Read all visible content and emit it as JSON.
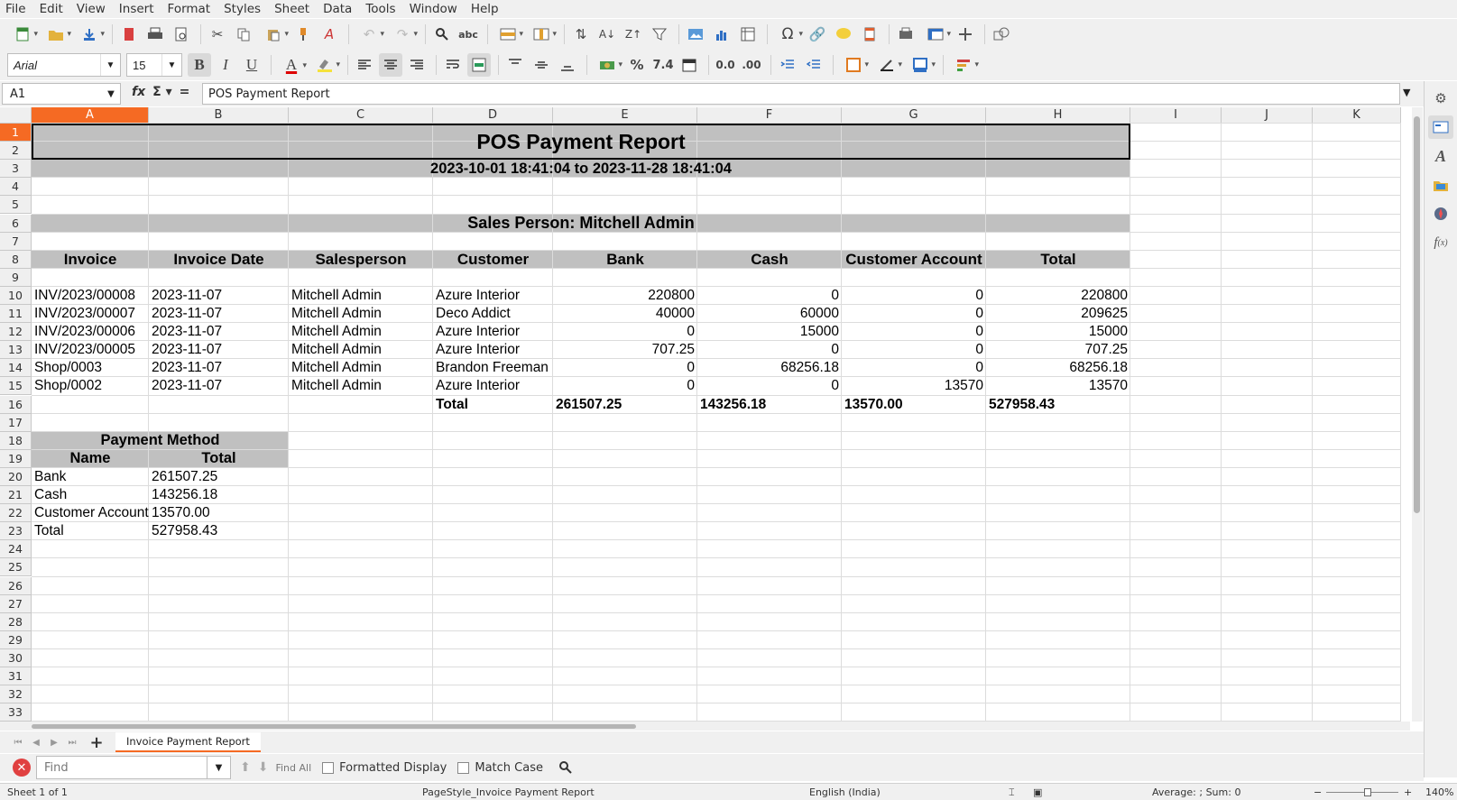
{
  "menu": [
    "File",
    "Edit",
    "View",
    "Insert",
    "Format",
    "Styles",
    "Sheet",
    "Data",
    "Tools",
    "Window",
    "Help"
  ],
  "toolbar": {
    "font_name": "Arial",
    "font_size": "15"
  },
  "formula_bar": {
    "cell_ref": "A1",
    "content": "POS Payment Report"
  },
  "columns": [
    "A",
    "B",
    "C",
    "D",
    "E",
    "F",
    "G",
    "H",
    "I",
    "J",
    "K"
  ],
  "rows": [
    "1",
    "2",
    "3",
    "4",
    "5",
    "6",
    "7",
    "8",
    "9",
    "10",
    "11",
    "12",
    "13",
    "14",
    "15",
    "16",
    "17",
    "18",
    "19",
    "20",
    "21",
    "22",
    "23",
    "24",
    "25",
    "26",
    "27",
    "28",
    "29",
    "30",
    "31",
    "32",
    "33"
  ],
  "report": {
    "title": "POS Payment Report",
    "period": "2023-10-01 18:41:04 to 2023-11-28 18:41:04",
    "salesperson_line": "Sales Person: Mitchell Admin",
    "headers": [
      "Invoice",
      "Invoice Date",
      "Salesperson",
      "Customer",
      "Bank",
      "Cash",
      "Customer Account",
      "Total"
    ],
    "rows": [
      [
        "INV/2023/00008",
        "2023-11-07",
        "Mitchell Admin",
        "Azure Interior",
        "220800",
        "0",
        "0",
        "220800"
      ],
      [
        "INV/2023/00007",
        "2023-11-07",
        "Mitchell Admin",
        "Deco Addict",
        "40000",
        "60000",
        "0",
        "209625"
      ],
      [
        "INV/2023/00006",
        "2023-11-07",
        "Mitchell Admin",
        "Azure Interior",
        "0",
        "15000",
        "0",
        "15000"
      ],
      [
        "INV/2023/00005",
        "2023-11-07",
        "Mitchell Admin",
        "Azure Interior",
        "707.25",
        "0",
        "0",
        "707.25"
      ],
      [
        "Shop/0003",
        "2023-11-07",
        "Mitchell Admin",
        "Brandon Freeman",
        "0",
        "68256.18",
        "0",
        "68256.18"
      ],
      [
        "Shop/0002",
        "2023-11-07",
        "Mitchell Admin",
        "Azure Interior",
        "0",
        "0",
        "13570",
        "13570"
      ]
    ],
    "totals": {
      "label": "Total",
      "bank": "261507.25",
      "cash": "143256.18",
      "customer_account": "13570.00",
      "total": "527958.43"
    },
    "payment_method": {
      "title": "Payment Method",
      "col_name": "Name",
      "col_total": "Total",
      "rows": [
        [
          "Bank",
          "261507.25"
        ],
        [
          "Cash",
          "143256.18"
        ],
        [
          "Customer Account",
          "13570.00"
        ],
        [
          "Total",
          "527958.43"
        ]
      ]
    }
  },
  "sheet_tab": "Invoice Payment Report",
  "find": {
    "placeholder": "Find",
    "find_all": "Find All",
    "formatted_display": "Formatted Display",
    "match_case": "Match Case"
  },
  "status": {
    "sheet": "Sheet 1 of 1",
    "page_style": "PageStyle_Invoice Payment Report",
    "language": "English (India)",
    "summary": "Average: ; Sum: 0",
    "zoom": "140%"
  }
}
